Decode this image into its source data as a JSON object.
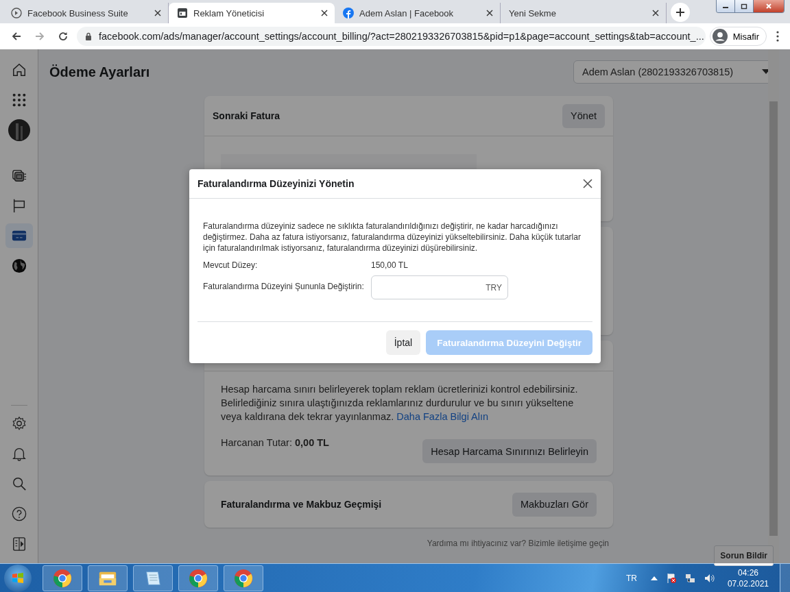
{
  "browser": {
    "tabs": [
      {
        "title": "Facebook Business Suite",
        "kind": "suite",
        "selected": false
      },
      {
        "title": "Reklam Yöneticisi",
        "kind": "ads",
        "selected": true
      },
      {
        "title": "Adem Aslan | Facebook",
        "kind": "facebook",
        "selected": false
      },
      {
        "title": "Yeni Sekme",
        "kind": "blank",
        "selected": false
      }
    ],
    "url": "facebook.com/ads/manager/account_settings/account_billing/?act=2802193326703815&pid=p1&page=account_settings&tab=account_...",
    "profile": "Misafir"
  },
  "sidebar": {
    "items": [
      {
        "kind": "home",
        "selected": false
      },
      {
        "kind": "apps",
        "selected": false
      },
      {
        "kind": "avatar",
        "selected": false
      },
      {
        "kind": "pages",
        "selected": false
      },
      {
        "kind": "flag",
        "selected": false
      },
      {
        "kind": "card",
        "selected": true
      },
      {
        "kind": "globe",
        "selected": false
      }
    ],
    "bottom_items": [
      {
        "kind": "settings"
      },
      {
        "kind": "bell"
      },
      {
        "kind": "search"
      },
      {
        "kind": "help"
      },
      {
        "kind": "panel"
      }
    ]
  },
  "page": {
    "title": "Ödeme Ayarları",
    "account_selector": "Adem Aslan (2802193326703815)",
    "next_invoice": {
      "title": "Sonraki Fatura",
      "button": "Yönet"
    },
    "spending_limit": {
      "description": "Hesap harcama sınırı belirleyerek toplam reklam ücretlerinizi kontrol edebilirsiniz. Belirlediğiniz sınıra ulaştığınızda reklamlarınız durdurulur ve bu sınırı yükseltene veya kaldırana dek tekrar yayınlanmaz.",
      "link": "Daha Fazla Bilgi Alın",
      "spent": "Harcanan Tutar: **0,00 TL**",
      "button": "Hesap Harcama Sınırınızı Belirleyin"
    },
    "history": {
      "title": "Faturalandırma ve Makbuz Geçmişi",
      "button": "Makbuzları Gör"
    },
    "footer": "Yardıma mı ihtiyacınız var? Bizimle iletişime geçin",
    "report_button": "Sorun Bildir"
  },
  "modal": {
    "title": "Faturalandırma Düzeyinizi Yönetin",
    "description": "Faturalandırma düzeyiniz sadece ne sıklıkta faturalandırıldığınızı değiştirir, ne kadar harcadığınızı değiştirmez. Daha az fatura istiyorsanız, faturalandırma düzeyinizi yükseltebilirsiniz. Daha küçük tutarlar için faturalandırılmak istiyorsanız, faturalandırma düzeyinizi düşürebilirsiniz.",
    "current_label": "Mevcut Düzey:",
    "current_value": "150,00 TL",
    "change_label": "Faturalandırma Düzeyini Şununla Değiştirin:",
    "currency": "TRY",
    "cancel": "İptal",
    "submit": "Faturalandırma Düzeyini Değiştir",
    "submit_disabled": true
  },
  "taskbar": {
    "apps": [
      {
        "kind": "chrome"
      },
      {
        "kind": "explorer"
      },
      {
        "kind": "notepad"
      },
      {
        "kind": "chrome"
      },
      {
        "kind": "chrome"
      }
    ],
    "language": "TR",
    "time": "04:26",
    "date": "07.02.2021"
  }
}
